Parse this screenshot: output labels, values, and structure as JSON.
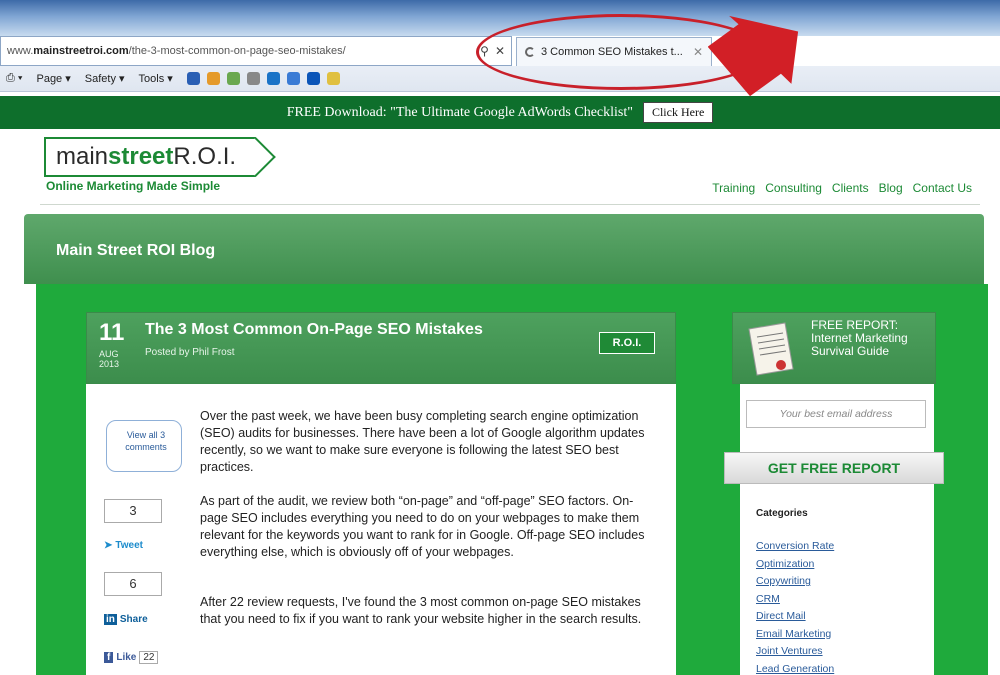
{
  "browser": {
    "url_prefix": "www.",
    "url_domain": "mainstreetroi.com",
    "url_path": "/the-3-most-common-on-page-seo-mistakes/",
    "tab_title": "3 Common SEO Mistakes t...",
    "toolbar": [
      "Page",
      "Safety",
      "Tools"
    ]
  },
  "announcement": {
    "text": "FREE Download: \"The Ultimate Google AdWords Checklist\"",
    "button": "Click Here"
  },
  "header": {
    "logo_light": "main",
    "logo_bold": "street",
    "logo_rest": " R.O.I.",
    "tagline": "Online Marketing Made Simple",
    "nav": [
      "Training",
      "Consulting",
      "Clients",
      "Blog",
      "Contact Us"
    ]
  },
  "blog": {
    "title": "Main Street ROI Blog"
  },
  "post": {
    "day": "11",
    "month": "AUG",
    "year": "2013",
    "title": "The 3 Most Common On-Page SEO Mistakes",
    "byline": "Posted by Phil Frost",
    "badge": "R.O.I.",
    "comments_link": "View all 3 comments",
    "tweet_count": "3",
    "tweet_label": "Tweet",
    "linkedin_count": "6",
    "linkedin_label": "Share",
    "fb_label": "Like",
    "fb_count": "22",
    "paragraphs": [
      "Over the past week, we have been busy completing search engine optimization (SEO) audits for businesses.  There have been a lot of Google algorithm updates recently, so we want to make sure everyone is following the latest SEO best practices.",
      "As part of the audit, we review both “on-page” and “off-page” SEO factors.  On-page SEO includes everything you need to do on your webpages to make them relevant for the keywords you want to rank for in Google.  Off-page SEO includes everything else, which is obviously off of your webpages.",
      "After 22 review requests, I've found the 3 most common on-page SEO mistakes that you need to fix if you want to rank your website higher in the search results."
    ]
  },
  "sidebar": {
    "report_line1": "FREE REPORT:",
    "report_line2": "Internet Marketing",
    "report_line3": "Survival Guide",
    "email_placeholder": "Your best email address",
    "button": "GET FREE REPORT",
    "categories_heading": "Categories",
    "categories": [
      "Conversion Rate",
      "Optimization",
      "Copywriting",
      "CRM",
      "Direct Mail",
      "Email Marketing",
      "Joint Ventures",
      "Lead Generation"
    ]
  },
  "colors": {
    "brand_green": "#1c8a35",
    "announce_bg": "#0e6f2c",
    "annotation_red": "#c8202a"
  }
}
